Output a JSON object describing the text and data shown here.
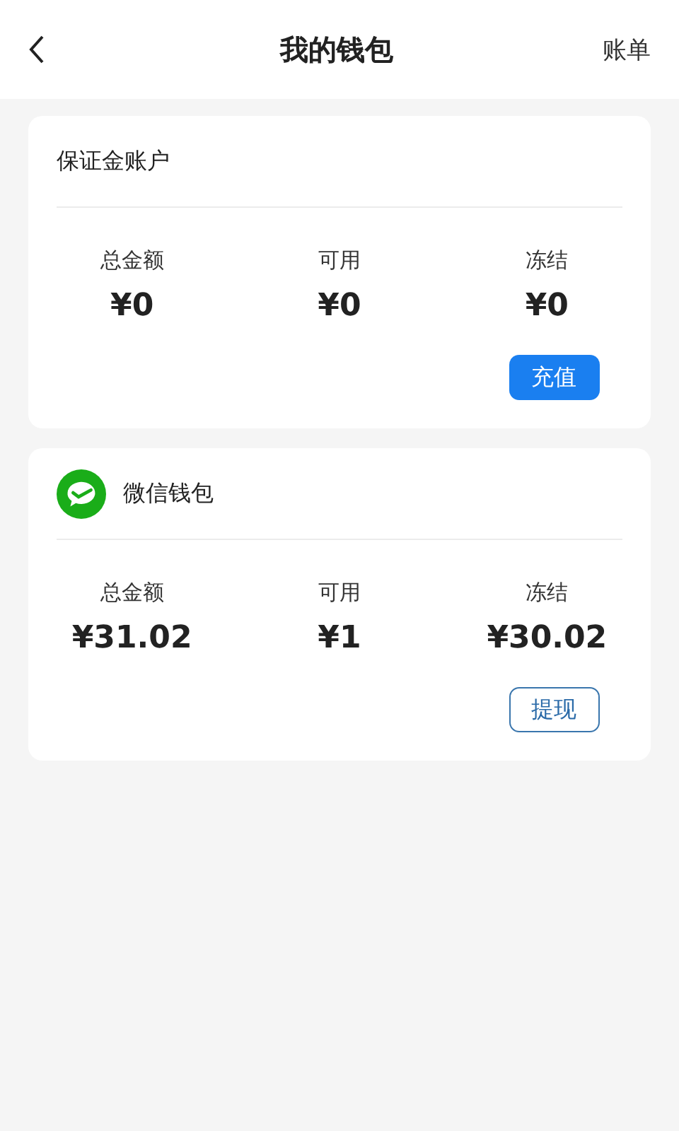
{
  "header": {
    "title": "我的钱包",
    "action": "账单"
  },
  "cards": [
    {
      "kind": "plain",
      "title": "保证金账户",
      "stats": [
        {
          "label": "总金额",
          "value": "¥0"
        },
        {
          "label": "可用",
          "value": "¥0"
        },
        {
          "label": "冻结",
          "value": "¥0"
        }
      ],
      "button": {
        "label": "充值",
        "kind": "filled"
      }
    },
    {
      "kind": "with_icon",
      "title": "微信钱包",
      "stats": [
        {
          "label": "总金额",
          "value": "¥31.02"
        },
        {
          "label": "可用",
          "value": "¥1"
        },
        {
          "label": "冻结",
          "value": "¥30.02"
        }
      ],
      "button": {
        "label": "提现",
        "kind": "outline"
      }
    }
  ]
}
